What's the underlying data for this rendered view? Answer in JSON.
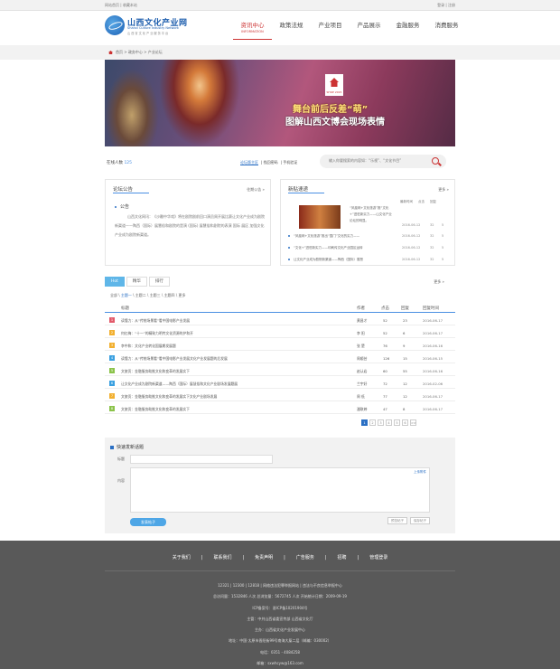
{
  "topbar": {
    "left": "网站首页 | 收藏本站",
    "right": "登录 | 注册"
  },
  "logo": {
    "cn": "山西文化产业网",
    "en": "Shanxi Culture Industry Network",
    "sub": "山 西 省 文 化 产 业 服 务 平 台"
  },
  "nav": [
    {
      "label": "资讯中心",
      "sub": "INFORMATION",
      "active": true
    },
    {
      "label": "政策法规"
    },
    {
      "label": "产业项目"
    },
    {
      "label": "产品展示"
    },
    {
      "label": "金融服务"
    },
    {
      "label": "消费服务"
    }
  ],
  "breadcrumb": {
    "home": "首页",
    "path": "> 政务中心 > 产业论坛"
  },
  "banner": {
    "logo_text": "SHOP 2015",
    "line1": "舞台前后反差“萌”",
    "line2": "图解山西文博会现场表情"
  },
  "online": {
    "label": "在线人数",
    "value": "125"
  },
  "search": {
    "tabs": [
      "论坛版主区",
      "找回密码",
      "手机验证"
    ],
    "placeholder": "输入你要搜索的内容如：“乐视”、“文化节目”"
  },
  "forum_notice": {
    "title": "论坛公告",
    "more": "往期公告 »",
    "item": "公告",
    "text": "山西文化网讯：《沙雕中华戏》将在剧院剧前回口演员周开展比赛让文化产业成为剧院新渠道——陶西（国际）展慧俗和剧院的是演 (国际) 展慧俗和剧院的表演 国际 展区 加强文化产业成为剧院新渠道。"
  },
  "new_posts": {
    "title": "新贴速递",
    "more": "更多 »",
    "headers": [
      "最新时间",
      "点击",
      "回复"
    ],
    "thumb_text": "“凤凰网+文化旅游”推“文化+”进驻新实力——山文化产业论坛的明显。",
    "rows": [
      {
        "text": "",
        "date": "2016-06-12",
        "c": "32",
        "r": "5"
      },
      {
        "text": "“凤凰网+文化旅游”推出“国门”文化的实力——",
        "sub": "“文化”",
        "date": "2016-06-12",
        "c": "32",
        "r": "5"
      },
      {
        "text": "“文化+”进驻新实力——印刷传文化产业园区运转",
        "date": "2016-06-12",
        "c": "32",
        "r": "5"
      },
      {
        "text": "让文化产业成为剧院新渠道——陶西（国际）展慧",
        "date": "2016-06-12",
        "c": "32",
        "r": "5"
      }
    ]
  },
  "list": {
    "tabs": [
      "Hot",
      "精华",
      "排行"
    ],
    "more": "更多 »",
    "filter": [
      "全部",
      "主题一",
      "主题二",
      "主题三",
      "主题四",
      "更多"
    ],
    "headers": {
      "title": "标题",
      "author": "作者",
      "clicks": "点击",
      "replies": "回复",
      "date": "回复时间"
    },
    "rows": [
      {
        "n": "1",
        "color": "#e25a6a",
        "title": "读懂力：从“传统场景看”看中国电影产业发展",
        "author": "黄昌才",
        "clicks": "52",
        "replies": "23",
        "date": "2016-06-17"
      },
      {
        "n": "2",
        "color": "#f2b030",
        "title": "何红梅：“十一”的精致力明传文化资源的护和开",
        "author": "李  阳",
        "clicks": "52",
        "replies": "6",
        "date": "2016-06-17"
      },
      {
        "n": "3",
        "color": "#f2b030",
        "title": "李中和：文化产业转化国展期发展题",
        "author": "张  楚",
        "clicks": "76",
        "replies": "9",
        "date": "2016-06-16"
      },
      {
        "n": "4",
        "color": "#3aa0e0",
        "title": "读懂力：从“传统场景看”看中国电影产业发展文化产业发展题的后发展",
        "author": "周顺芸",
        "clicks": "126",
        "replies": "15",
        "date": "2016-06-15"
      },
      {
        "n": "5",
        "color": "#8bc34a",
        "title": "文旅贡：金融服务助推文化和变革的发展实下",
        "author": "赵认岩",
        "clicks": "60",
        "replies": "55",
        "date": "2016-06-16"
      },
      {
        "n": "6",
        "color": "#3aa0e0",
        "title": "让文化产业成为剧院新渠道——陶西（国际）展慧俗和文化产业剧场发展题展",
        "author": "兰宇好",
        "clicks": "72",
        "replies": "12",
        "date": "2016-02-06"
      },
      {
        "n": "7",
        "color": "#f2b030",
        "title": "文旅贡：金融服务助推文化和变革的发展实下文化产业剧场发展",
        "author": "周  低",
        "clicks": "77",
        "replies": "12",
        "date": "2016-06-17"
      },
      {
        "n": "8",
        "color": "#8bc34a",
        "title": "文旅贡：金融服务助推文化和变革的发展实下",
        "author": "潘联婷",
        "clicks": "47",
        "replies": "8",
        "date": "2016-06-17"
      }
    ],
    "pages": [
      "1",
      "2",
      "3",
      "4",
      "5",
      "6",
      ">>"
    ]
  },
  "quick_post": {
    "title": "快速发新话题",
    "title_label": "标题",
    "content_label": "内容",
    "upload": "上传附件",
    "submit": "发表帖子",
    "btn2": "预览帖子",
    "btn3": "保存帖子"
  },
  "footer": {
    "links": [
      "关于我们",
      "|",
      "联系我们",
      "|",
      "免责声明",
      "|",
      "广告服务",
      "|",
      "招聘",
      "|",
      "管理登录"
    ],
    "lines": [
      "12321 | 12300 | 12818 | 网络违法犯罪举报网站 | 违法与不良信息举报中心",
      "总访问量：1532846 人次  总浏览量：5672745 人次  开始统计日期：2009-09-19",
      "ICP备案号：晋ICP备10201904号",
      "主管：中共山西省委宣传部 山西省文化厅",
      "主办：山西省文化产业发展中心",
      "地址：中国·太原市晋阳街99号南海大厦二层（邮编：030002）",
      "电话：0351 - 4084258",
      "邮箱：sxwhcyw@163.com"
    ]
  }
}
